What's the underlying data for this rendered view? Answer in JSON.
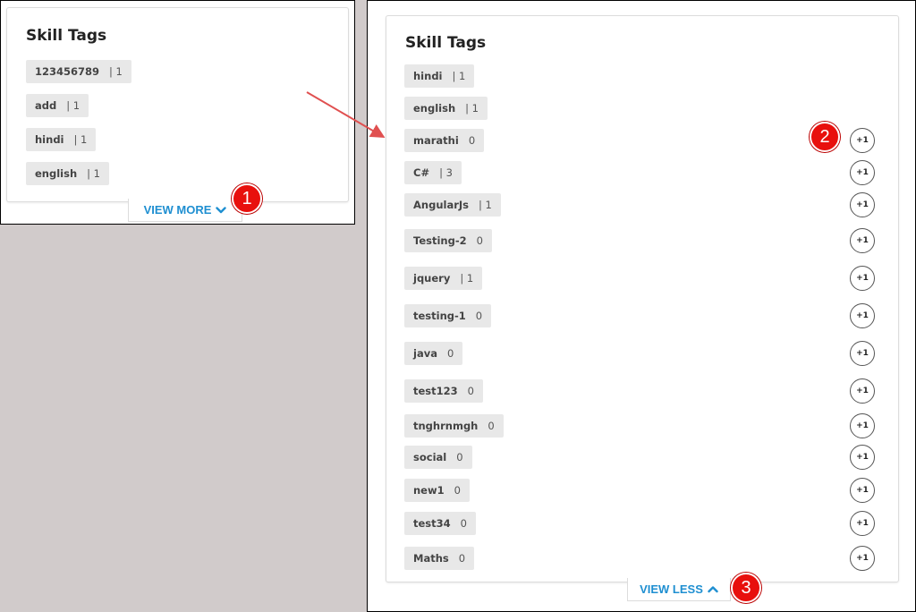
{
  "colors": {
    "accent": "#1f8fd1",
    "callout": "#e8100d",
    "tag_bg": "#e8e8e8",
    "backdrop": "#d1cbcb"
  },
  "left_card": {
    "title": "Skill Tags",
    "tags": [
      {
        "name": "123456789",
        "count": "| 1"
      },
      {
        "name": "add",
        "count": "| 1"
      },
      {
        "name": "hindi",
        "count": "| 1"
      },
      {
        "name": "english",
        "count": "| 1"
      }
    ],
    "view_more": {
      "label": "VIEW MORE",
      "icon": "chevron-down-icon"
    },
    "callout": "1"
  },
  "right_card": {
    "title": "Skill Tags",
    "tags": [
      {
        "name": "hindi",
        "count": "| 1"
      },
      {
        "name": "english",
        "count": "| 1"
      },
      {
        "name": "marathi",
        "count": "0",
        "plus": "+1"
      },
      {
        "name": "C#",
        "count": "| 3",
        "plus": "+1"
      },
      {
        "name": "AngularJs",
        "count": "| 1",
        "plus": "+1"
      },
      {
        "name": "Testing-2",
        "count": "0",
        "plus": "+1"
      },
      {
        "name": "jquery",
        "count": "| 1",
        "plus": "+1"
      },
      {
        "name": "testing-1",
        "count": "0",
        "plus": "+1"
      },
      {
        "name": "java",
        "count": "0",
        "plus": "+1"
      },
      {
        "name": "test123",
        "count": "0",
        "plus": "+1"
      },
      {
        "name": "tnghrnmgh",
        "count": "0",
        "plus": "+1"
      },
      {
        "name": "social",
        "count": "0",
        "plus": "+1"
      },
      {
        "name": "new1",
        "count": "0",
        "plus": "+1"
      },
      {
        "name": "test34",
        "count": "0",
        "plus": "+1"
      },
      {
        "name": "Maths",
        "count": "0",
        "plus": "+1"
      }
    ],
    "view_less": {
      "label": "VIEW LESS",
      "icon": "chevron-up-icon"
    },
    "callouts": [
      "2",
      "3"
    ]
  }
}
